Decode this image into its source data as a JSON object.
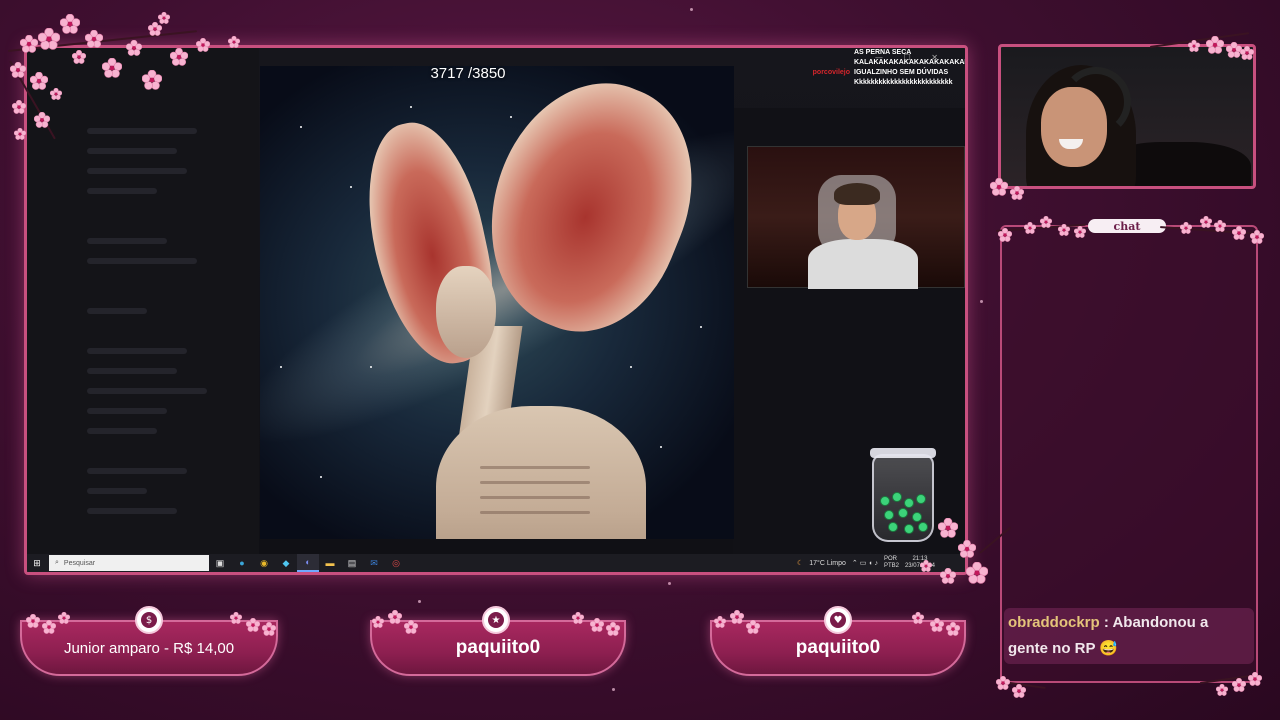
{
  "stream": {
    "counter": "3717 /3850",
    "chat_header": "chat"
  },
  "overlay_chat": [
    {
      "user": "",
      "message": "AS PERNA SECA"
    },
    {
      "user": "",
      "message": "KALAKAKAKAKAKAKAKAKAKAKAKAKA"
    },
    {
      "user": "porcovilejo",
      "message": "IGUALZINHO SEM DÚVIDAS"
    },
    {
      "user": "",
      "message": "Kkkkkkkkkkkkkkkkkkkkkkkkk"
    }
  ],
  "chat": {
    "messages": [
      {
        "user": "obraddockrp",
        "separator": " : ",
        "text": "Abandonou a gente no RP",
        "emoji": "😅"
      }
    ]
  },
  "banners": [
    {
      "label": "Junior amparo - R$ 14,00",
      "badge_icon": "dollar-icon",
      "badge_glyph": "$"
    },
    {
      "label": "paquiito0",
      "badge_icon": "star-icon",
      "badge_glyph": "★"
    },
    {
      "label": "paquiito0",
      "badge_icon": "heart-icon",
      "badge_glyph": "♥"
    }
  ],
  "taskbar": {
    "search_placeholder": "Pesquisar",
    "weather": "17°C  Limpo",
    "lang": "POR",
    "lang2": "PTB2",
    "time": "21:13",
    "date": "23/07/2024"
  },
  "colors": {
    "accent": "#c8507f",
    "background": "#3f0f30",
    "banner": "#a8285f",
    "chat_username": "#e4c47a",
    "overlay_username": "#d8262c"
  }
}
